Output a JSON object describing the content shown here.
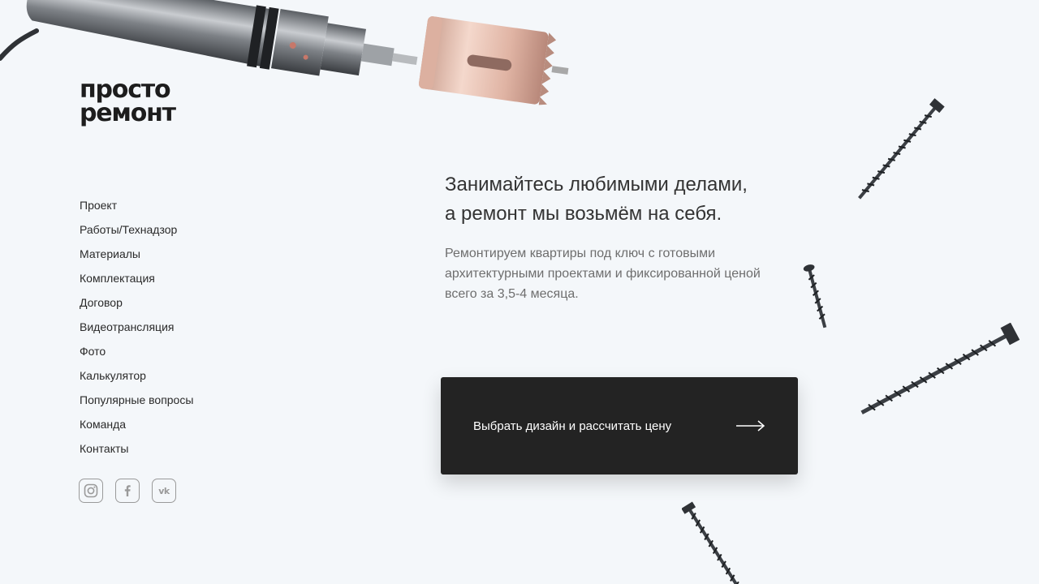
{
  "brand": {
    "line1": "просто",
    "line2": "ремонт"
  },
  "nav": {
    "items": [
      {
        "label": "Проект"
      },
      {
        "label": "Работы/Технадзор"
      },
      {
        "label": "Материалы"
      },
      {
        "label": "Комплектация"
      },
      {
        "label": "Договор"
      },
      {
        "label": "Видеотрансляция"
      },
      {
        "label": "Фото"
      },
      {
        "label": "Калькулятор"
      },
      {
        "label": "Популярные вопросы"
      },
      {
        "label": "Команда"
      },
      {
        "label": "Контакты"
      }
    ]
  },
  "social": {
    "vk_label": "vk",
    "icons": [
      "instagram-icon",
      "facebook-icon",
      "vk-icon"
    ]
  },
  "hero": {
    "headline_line1": "Занимайтесь любимыми делами,",
    "headline_line2": "а ремонт мы возьмём на себя.",
    "description": "Ремонтируем квартиры под ключ с готовыми архитектурными проектами и фиксированной ценой всего за 3,5-4 месяца.",
    "cta_label": "Выбрать дизайн и рассчитать цену"
  },
  "colors": {
    "background": "#f4f7fa",
    "cta_background": "#232323",
    "text_primary": "#2b2b2b",
    "text_secondary": "#6e6e6e",
    "icon_border": "#9a9a9a"
  }
}
